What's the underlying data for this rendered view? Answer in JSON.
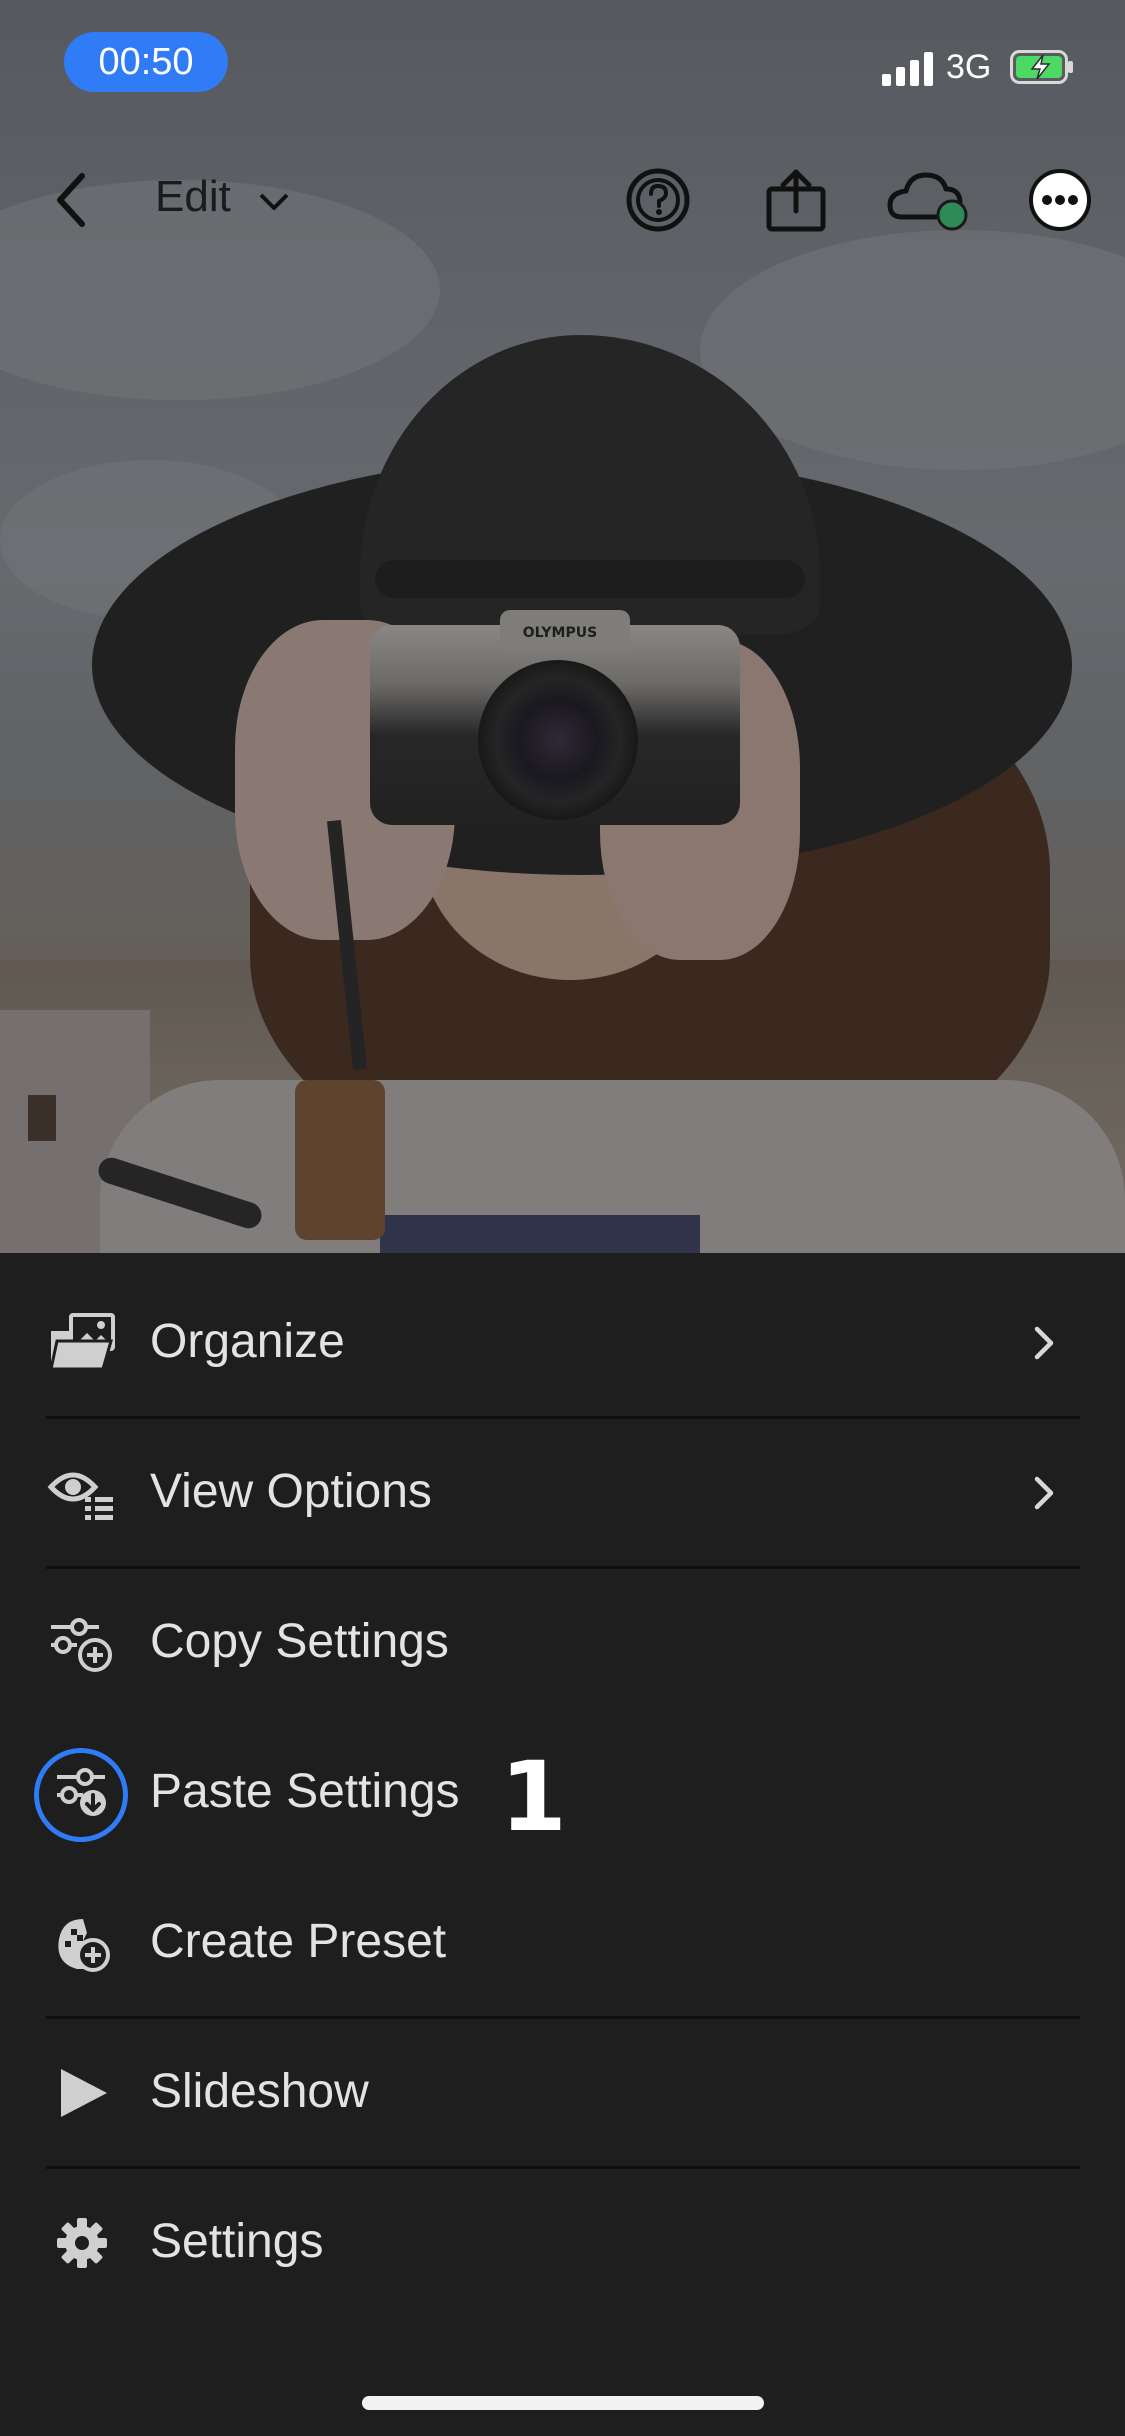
{
  "status_bar": {
    "time": "00:50",
    "network": "3G",
    "accent_color": "#2f7cf6",
    "battery_state": "charging"
  },
  "toolbar": {
    "edit_label": "Edit",
    "icons": [
      "back-chevron-icon",
      "help-icon",
      "share-icon",
      "cloud-sync-icon",
      "more-icon"
    ]
  },
  "photo": {
    "camera_brand": "OLYMPUS"
  },
  "menu": {
    "items": [
      {
        "label": "Organize",
        "icon": "folder-image-icon",
        "has_submenu": true
      },
      {
        "label": "View Options",
        "icon": "eye-list-icon",
        "has_submenu": true
      },
      {
        "label": "Copy Settings",
        "icon": "sliders-plus-icon",
        "has_submenu": false
      },
      {
        "label": "Paste Settings",
        "icon": "sliders-download-icon",
        "has_submenu": false
      },
      {
        "label": "Create Preset",
        "icon": "preset-plus-icon",
        "has_submenu": false
      },
      {
        "label": "Slideshow",
        "icon": "play-icon",
        "has_submenu": false
      },
      {
        "label": "Settings",
        "icon": "gear-icon",
        "has_submenu": false
      }
    ]
  },
  "annotation": {
    "step_number": "1",
    "highlight_color": "#2f7cf6"
  }
}
